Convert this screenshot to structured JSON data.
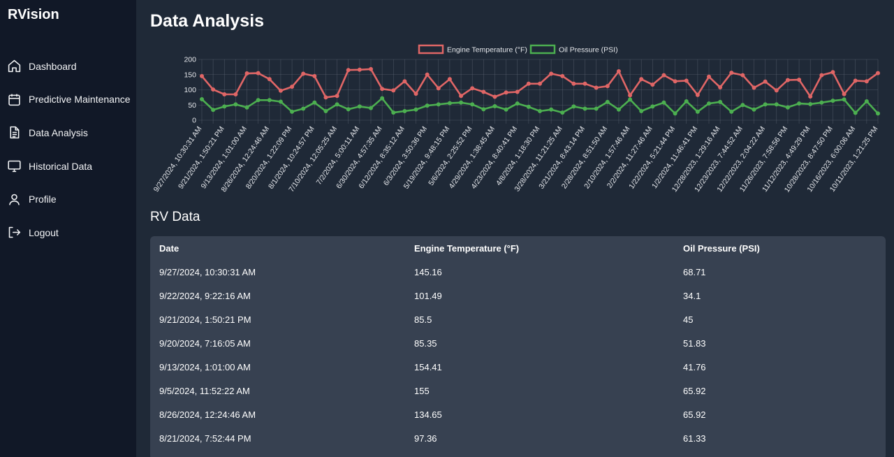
{
  "sidebar": {
    "brand": "RVision",
    "items": [
      {
        "label": "Dashboard",
        "icon": "home-icon"
      },
      {
        "label": "Predictive Maintenance",
        "icon": "calendar-icon"
      },
      {
        "label": "Data Analysis",
        "icon": "document-icon"
      },
      {
        "label": "Historical Data",
        "icon": "monitor-icon"
      },
      {
        "label": "Profile",
        "icon": "user-icon"
      },
      {
        "label": "Logout",
        "icon": "logout-icon"
      }
    ]
  },
  "main": {
    "title": "Data Analysis",
    "section_title": "RV Data"
  },
  "colors": {
    "engine": "#e06666",
    "oil": "#4caf50",
    "grid": "#6b7280",
    "background": "#1f2937",
    "sidebar": "#111827",
    "card": "#374151"
  },
  "table": {
    "headers": [
      "Date",
      "Engine Temperature (°F)",
      "Oil Pressure (PSI)"
    ],
    "rows": [
      [
        "9/27/2024, 10:30:31 AM",
        "145.16",
        "68.71"
      ],
      [
        "9/22/2024, 9:22:16 AM",
        "101.49",
        "34.1"
      ],
      [
        "9/21/2024, 1:50:21 PM",
        "85.5",
        "45"
      ],
      [
        "9/20/2024, 7:16:05 AM",
        "85.35",
        "51.83"
      ],
      [
        "9/13/2024, 1:01:00 AM",
        "154.41",
        "41.76"
      ],
      [
        "9/5/2024, 11:52:22 AM",
        "155",
        "65.92"
      ],
      [
        "8/26/2024, 12:24:46 AM",
        "134.65",
        "65.92"
      ],
      [
        "8/21/2024, 7:52:44 PM",
        "97.36",
        "61.33"
      ]
    ]
  },
  "chart_data": {
    "type": "line",
    "legend_position": "top",
    "grid": true,
    "ylim": [
      0,
      200
    ],
    "yticks": [
      0,
      50,
      100,
      150,
      200
    ],
    "x_labels": [
      "9/27/2024, 10:30:31 AM",
      "9/21/2024, 1:50:21 PM",
      "9/13/2024, 1:01:00 AM",
      "8/26/2024, 12:24:46 AM",
      "8/20/2024, 1:22:09 PM",
      "8/1/2024, 10:24:57 PM",
      "7/10/2024, 12:05:25 AM",
      "7/2/2024, 5:00:11 AM",
      "6/30/2024, 4:57:35 AM",
      "6/12/2024, 8:35:12 AM",
      "6/3/2024, 3:50:36 PM",
      "5/19/2024, 9:48:15 PM",
      "5/6/2024, 2:25:52 PM",
      "4/29/2024, 1:38:45 AM",
      "4/23/2024, 8:40:41 PM",
      "4/8/2024, 1:18:30 PM",
      "3/28/2024, 11:21:25 AM",
      "3/21/2024, 8:43:14 PM",
      "2/28/2024, 8:51:50 AM",
      "2/10/2024, 1:57:46 AM",
      "2/2/2024, 11:27:46 AM",
      "1/22/2024, 5:21:44 PM",
      "1/2/2024, 11:46:41 PM",
      "12/28/2023, 1:29:16 AM",
      "12/23/2023, 7:44:52 AM",
      "12/22/2023, 2:04:22 AM",
      "11/26/2023, 7:58:56 PM",
      "11/12/2023, 4:49:29 PM",
      "10/28/2023, 8:47:50 PM",
      "10/16/2023, 6:00:06 AM",
      "10/11/2023, 1:21:25 PM"
    ],
    "series": [
      {
        "name": "Engine Temperature (°F)",
        "values": [
          145,
          101,
          85,
          85,
          154,
          155,
          135,
          97,
          110,
          153,
          145,
          75,
          80,
          165,
          166,
          168,
          103,
          98,
          128,
          87,
          150,
          105,
          135,
          80,
          105,
          93,
          77,
          91,
          93,
          120,
          120,
          153,
          145,
          120,
          120,
          107,
          112,
          161,
          82,
          135,
          117,
          148,
          128,
          130,
          83,
          143,
          108,
          156,
          148,
          107,
          127,
          98,
          132,
          133,
          78,
          148,
          158,
          86,
          130,
          128,
          155
        ]
      },
      {
        "name": "Oil Pressure (PSI)",
        "values": [
          69,
          34,
          45,
          52,
          42,
          66,
          66,
          61,
          28,
          38,
          58,
          30,
          52,
          36,
          45,
          40,
          72,
          25,
          30,
          35,
          48,
          52,
          56,
          58,
          52,
          36,
          46,
          35,
          55,
          44,
          30,
          35,
          25,
          45,
          38,
          38,
          60,
          35,
          68,
          30,
          45,
          58,
          22,
          62,
          28,
          55,
          60,
          28,
          50,
          35,
          52,
          52,
          42,
          55,
          53,
          58,
          64,
          68,
          24,
          62,
          22
        ]
      }
    ]
  }
}
